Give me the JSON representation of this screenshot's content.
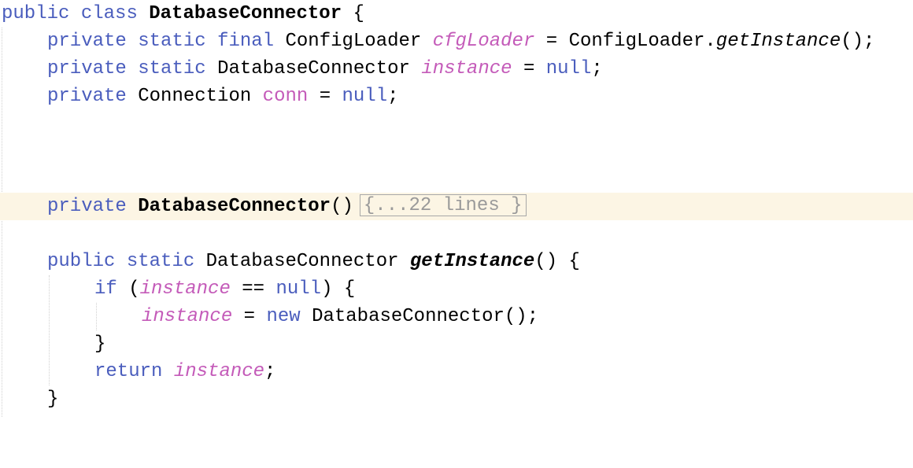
{
  "code": {
    "line1": {
      "kw_public": "public",
      "kw_class": "class",
      "class_name": "DatabaseConnector",
      "brace": "{"
    },
    "line2": {
      "kw_private": "private",
      "kw_static": "static",
      "kw_final": "final",
      "type": "ConfigLoader",
      "field": "cfgLoader",
      "eq": "=",
      "owner": "ConfigLoader.",
      "method": "getInstance",
      "tail": "();"
    },
    "line3": {
      "kw_private": "private",
      "kw_static": "static",
      "type": "DatabaseConnector",
      "field": "instance",
      "eq": "=",
      "null": "null",
      "semi": ";"
    },
    "line4": {
      "kw_private": "private",
      "type": "Connection",
      "field": "conn",
      "eq": "=",
      "null": "null",
      "semi": ";"
    },
    "line5": {
      "kw_private": "private",
      "ctor": "DatabaseConnector",
      "parens": "()",
      "fold": "{...22 lines }"
    },
    "line6": {
      "kw_public": "public",
      "kw_static": "static",
      "type": "DatabaseConnector",
      "method": "getInstance",
      "tail": "() {"
    },
    "line7": {
      "kw_if": "if",
      "open": "(",
      "field": "instance",
      "op": "==",
      "null": "null",
      "close": ") {"
    },
    "line8": {
      "field": "instance",
      "eq": "=",
      "kw_new": "new",
      "ctor": "DatabaseConnector",
      "tail": "();"
    },
    "line9": {
      "brace": "}"
    },
    "line10": {
      "kw_return": "return",
      "field": "instance",
      "semi": ";"
    },
    "line11": {
      "brace": "}"
    }
  },
  "colors": {
    "keyword": "#4a5dbd",
    "field": "#c45bb9",
    "highlight_line": "#fcf5e4",
    "fold_text": "#9a9a9a"
  }
}
